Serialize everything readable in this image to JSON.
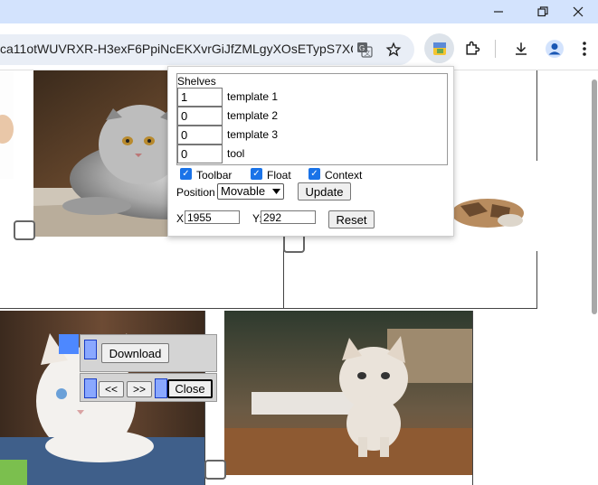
{
  "browser": {
    "url": "ca11otWUVRXR-H3exF6PpiNcEKXvrGiJfZMLgyXOsETypS7XQX...",
    "icons": [
      "minimize-icon",
      "restore-icon",
      "close-icon",
      "translate-icon",
      "star-icon",
      "extension-active-icon",
      "puzzle-icon",
      "download-icon",
      "profile-icon",
      "more-icon"
    ]
  },
  "panel": {
    "shelves_title": "Shelves",
    "shelves": [
      {
        "value": "1",
        "label": "template 1"
      },
      {
        "value": "0",
        "label": "template 2"
      },
      {
        "value": "0",
        "label": "template 3"
      },
      {
        "value": "0",
        "label": "tool"
      }
    ],
    "toolbar_label": "Toolbar",
    "float_label": "Float",
    "context_label": "Context",
    "position_label": "Position",
    "position_value": "Movable",
    "update_label": "Update",
    "x_label": "X:",
    "x_value": "1955",
    "y_label": "Y:",
    "y_value": "292",
    "reset_label": "Reset"
  },
  "widget": {
    "download_label": "Download",
    "prev_label": "<<",
    "next_label": ">>",
    "close_label": "Close"
  },
  "colors": {
    "titlebar": "#d3e3fd",
    "accent": "#1a73e8",
    "widget_blue": "#4d88ff"
  }
}
